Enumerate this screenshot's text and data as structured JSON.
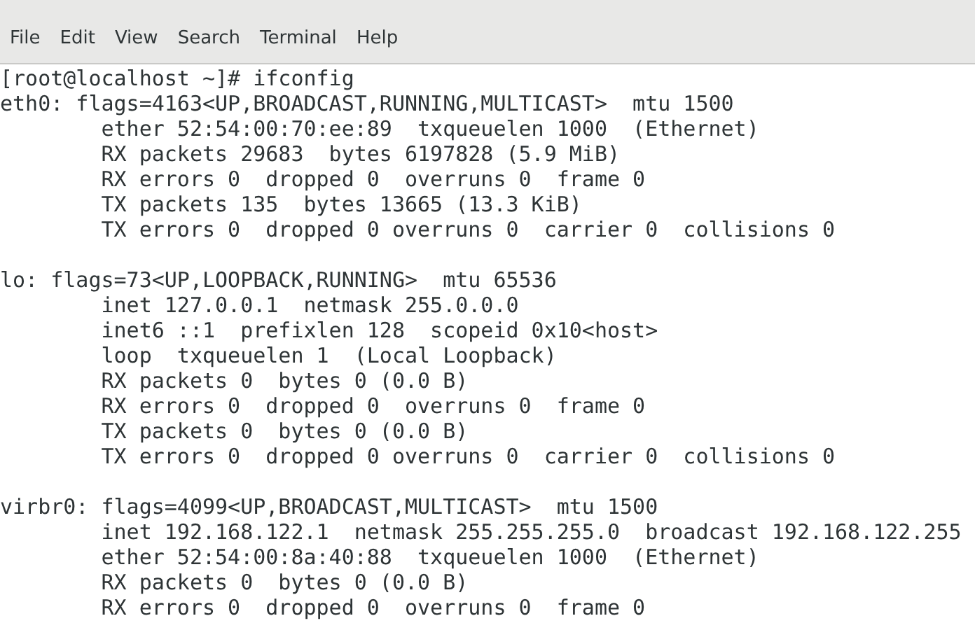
{
  "menu_bar": [
    {
      "label": "File"
    },
    {
      "label": "Edit"
    },
    {
      "label": "View"
    },
    {
      "label": "Search"
    },
    {
      "label": "Terminal"
    },
    {
      "label": "Help"
    }
  ],
  "terminal": {
    "command_line": "[root@localhost ~]# ifconfig",
    "blocks": [
      {
        "lines": [
          "eth0: flags=4163<UP,BROADCAST,RUNNING,MULTICAST>  mtu 1500",
          "        ether 52:54:00:70:ee:89  txqueuelen 1000  (Ethernet)",
          "        RX packets 29683  bytes 6197828 (5.9 MiB)",
          "        RX errors 0  dropped 0  overruns 0  frame 0",
          "        TX packets 135  bytes 13665 (13.3 KiB)",
          "        TX errors 0  dropped 0 overruns 0  carrier 0  collisions 0"
        ]
      },
      {
        "lines": [
          "lo: flags=73<UP,LOOPBACK,RUNNING>  mtu 65536",
          "        inet 127.0.0.1  netmask 255.0.0.0",
          "        inet6 ::1  prefixlen 128  scopeid 0x10<host>",
          "        loop  txqueuelen 1  (Local Loopback)",
          "        RX packets 0  bytes 0 (0.0 B)",
          "        RX errors 0  dropped 0  overruns 0  frame 0",
          "        TX packets 0  bytes 0 (0.0 B)",
          "        TX errors 0  dropped 0 overruns 0  carrier 0  collisions 0"
        ]
      },
      {
        "lines": [
          "virbr0: flags=4099<UP,BROADCAST,MULTICAST>  mtu 1500",
          "        inet 192.168.122.1  netmask 255.255.255.0  broadcast 192.168.122.255",
          "        ether 52:54:00:8a:40:88  txqueuelen 1000  (Ethernet)",
          "        RX packets 0  bytes 0 (0.0 B)",
          "        RX errors 0  dropped 0  overruns 0  frame 0"
        ]
      }
    ]
  }
}
